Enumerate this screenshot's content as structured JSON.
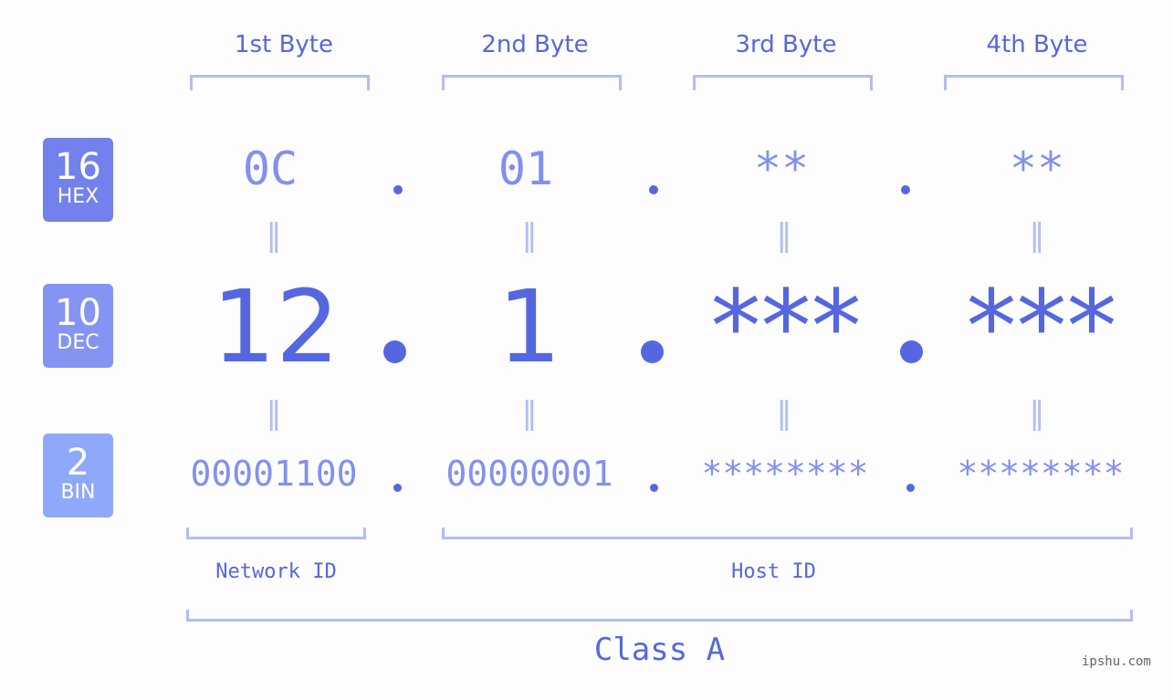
{
  "headers": [
    "1st Byte",
    "2nd Byte",
    "3rd Byte",
    "4th Byte"
  ],
  "badges": [
    {
      "num": "16",
      "label": "HEX",
      "color": "#7381ec"
    },
    {
      "num": "10",
      "label": "DEC",
      "color": "#8594f2"
    },
    {
      "num": "2",
      "label": "BIN",
      "color": "#8ea8fa"
    }
  ],
  "hex": [
    "0C",
    "01",
    "**",
    "**"
  ],
  "dec": [
    "12",
    "1",
    "***",
    "***"
  ],
  "bin": [
    "00001100",
    "00000001",
    "********",
    "********"
  ],
  "equals": "=",
  "network_label": "Network ID",
  "host_label": "Host ID",
  "class_label": "Class A",
  "watermark": "ipshu.com"
}
